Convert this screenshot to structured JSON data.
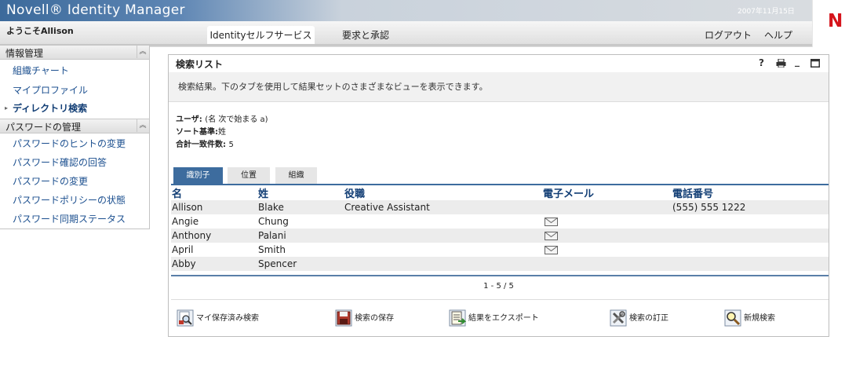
{
  "app": {
    "brand": "Novell® Identity Manager",
    "date": "2007年11月15日",
    "logo_letter": "N",
    "welcome": "ようこそAllison"
  },
  "nav": {
    "tabs": [
      {
        "label": "Identityセルフサービス",
        "active": true
      },
      {
        "label": "要求と承認",
        "active": false
      }
    ],
    "logout": "ログアウト",
    "help": "ヘルプ"
  },
  "sidebar": {
    "sections": [
      {
        "title": "情報管理",
        "items": [
          {
            "label": "組織チャート",
            "active": false
          },
          {
            "label": "マイプロファイル",
            "active": false
          },
          {
            "label": "ディレクトリ検索",
            "active": true
          }
        ]
      },
      {
        "title": "パスワードの管理",
        "items": [
          {
            "label": "パスワードのヒントの変更",
            "active": false
          },
          {
            "label": "パスワード確認の回答",
            "active": false
          },
          {
            "label": "パスワードの変更",
            "active": false
          },
          {
            "label": "パスワードポリシーの状態",
            "active": false
          },
          {
            "label": "パスワード同期ステータス",
            "active": false
          }
        ]
      }
    ]
  },
  "panel": {
    "title": "検索リスト",
    "controls": {
      "help": "?",
      "print": "print-icon",
      "minimize": "_",
      "maximize": "maximize-icon"
    },
    "description": "検索結果。下のタブを使用して結果セットのさまざまなビューを表示できます。",
    "criteria": {
      "user_label": "ユーザ:",
      "user_value": "(名 次で始まる a)",
      "sort_label": "ソート基準:",
      "sort_value": "姓",
      "total_label": "合計一致件数:",
      "total_value": "5"
    },
    "result_tabs": [
      "識別子",
      "位置",
      "組織"
    ],
    "table": {
      "headers": [
        "名",
        "姓",
        "役職",
        "電子メール",
        "電話番号"
      ],
      "rows": [
        {
          "first": "Allison",
          "last": "Blake",
          "title": "Creative Assistant",
          "email_icon": false,
          "phone": "(555) 555 1222"
        },
        {
          "first": "Angie",
          "last": "Chung",
          "title": "",
          "email_icon": true,
          "phone": ""
        },
        {
          "first": "Anthony",
          "last": "Palani",
          "title": "",
          "email_icon": true,
          "phone": ""
        },
        {
          "first": "April",
          "last": "Smith",
          "title": "",
          "email_icon": true,
          "phone": ""
        },
        {
          "first": "Abby",
          "last": "Spencer",
          "title": "",
          "email_icon": false,
          "phone": ""
        }
      ]
    },
    "pager": "1 - 5 / 5",
    "actions": [
      {
        "label": "マイ保存済み検索",
        "icon": "saved-searches-icon"
      },
      {
        "label": "検索の保存",
        "icon": "save-disk-icon"
      },
      {
        "label": "結果をエクスポート",
        "icon": "export-icon"
      },
      {
        "label": "検索の訂正",
        "icon": "refine-tools-icon"
      },
      {
        "label": "新規検索",
        "icon": "new-search-icon"
      }
    ]
  }
}
